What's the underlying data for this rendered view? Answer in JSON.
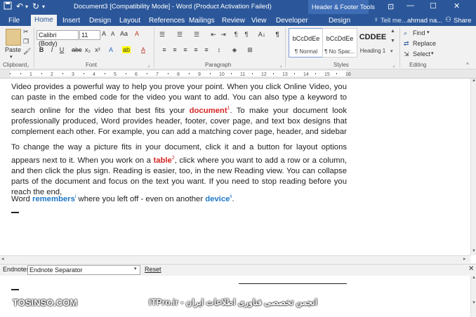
{
  "title_bar": {
    "title": "Document3 [Compatibility Mode] - Word (Product Activation Failed)",
    "contextual_group": "Header & Footer Tools",
    "restore_icon": "ribbon-display-icon",
    "minimize": "—",
    "maximize": "☐",
    "close": "✕"
  },
  "tabs": {
    "file": "File",
    "home": "Home",
    "insert": "Insert",
    "design": "Design",
    "layout": "Layout",
    "references": "References",
    "mailings": "Mailings",
    "review": "Review",
    "view": "View",
    "developer": "Developer",
    "hf_design": "Design",
    "tell_me": "Tell me...",
    "user": "ahmad na...",
    "share": "Share"
  },
  "ribbon": {
    "clipboard": {
      "paste": "Paste",
      "label": "Clipboard"
    },
    "font": {
      "name": "Calibri (Body)",
      "size": "11",
      "label": "Font"
    },
    "paragraph": {
      "label": "Paragraph"
    },
    "styles": {
      "label": "Styles",
      "items": [
        {
          "sample": "bCcDdEe",
          "name": "¶ Normal"
        },
        {
          "sample": "bCcDdEe",
          "name": "¶ No Spac..."
        },
        {
          "sample": "CDDEE",
          "name": "Heading 1"
        }
      ]
    },
    "editing": {
      "find": "Find",
      "replace": "Replace",
      "select": "Select",
      "label": "Editing"
    }
  },
  "document": {
    "p1_a": "Video provides a powerful way to help you prove your point. When you click Online Video, you can paste in the embed code for the video you want to add. You can also type a keyword to search online for the video that best fits your ",
    "p1_word": "document",
    "p1_sup": "1",
    "p1_b": ". To make your document look professionally produced, Word provides header, footer, cover page, and text box designs that complement each other. For example, you can add a matching cover page, header, and sidebar",
    "p2_a": "To change the way a picture fits in your document, click it and a button for layout options appears next to it. When you work on a ",
    "p2_word": "table",
    "p2_sup": "2",
    "p2_b": ", click where you want to add a row or a column, and then click the plus sign. Reading is easier, too, in the new Reading view. You can collapse parts of the document and focus on the text you want. If you need to stop reading before you reach the end,",
    "p3_a": "Word ",
    "p3_word1": "remembers",
    "p3_sup1": "i",
    "p3_b": " where you left off - even on another ",
    "p3_word2": "device",
    "p3_sup2": "ii",
    "p3_c": "."
  },
  "notes_pane": {
    "type_label": "Endnotes",
    "dropdown_value": "Endnote Separator",
    "reset": "Reset",
    "close": "✕"
  },
  "watermarks": {
    "left": "TOSINSO.COM",
    "right": "ITPro.ir - انجمن تخصصی فناوری اطلاعات ایران"
  }
}
